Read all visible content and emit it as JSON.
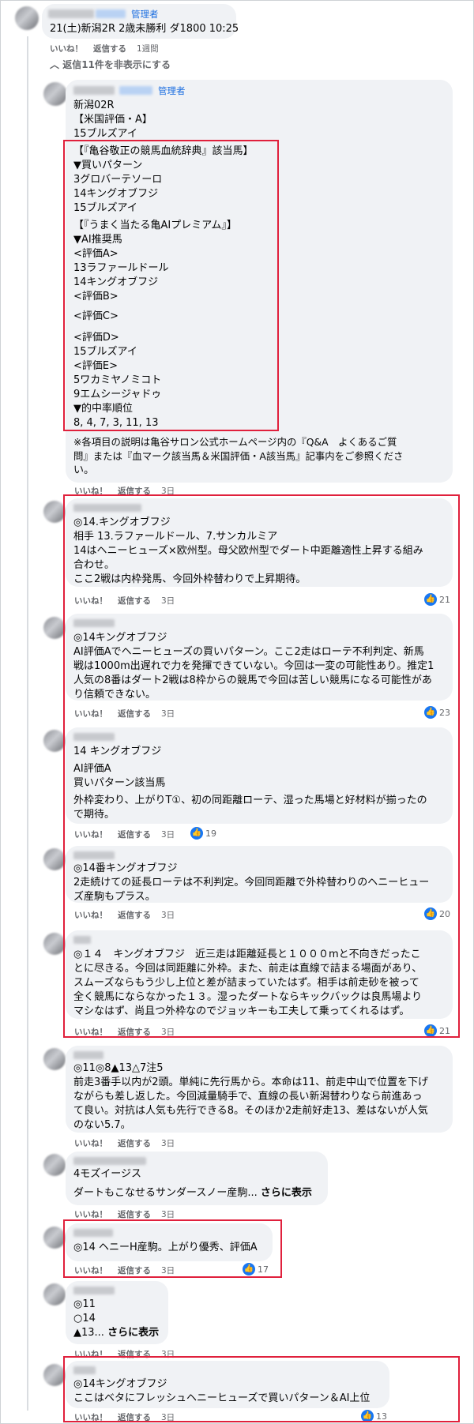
{
  "post": {
    "admin_badge": "管理者",
    "title": "21(土)新潟2R 2歳未勝利 ダ1800 10:25",
    "actions": {
      "like": "いいね！",
      "reply": "返信する",
      "time": "1週間"
    }
  },
  "hide_replies": "返信11件を非表示にする",
  "reply_admin": {
    "admin_badge": "管理者",
    "lines": [
      "新潟02R",
      "【米国評価・A】",
      "15ブルズアイ",
      "【『亀谷敬正の競馬血統辞典』該当馬】",
      "▼買いパターン",
      "3グロバーテソーロ",
      "14キングオブフジ",
      "15ブルズアイ",
      "【『うまく当たる亀AIプレミアム』】",
      "▼AI推奨馬",
      "<評価A>",
      "13ラファールドール",
      "14キングオブフジ",
      "<評価B>",
      "<評価C>",
      "<評価D>",
      "15ブルズアイ",
      "<評価E>",
      "5ワカミヤノミコト",
      "9エムシージャドゥ",
      "▼的中率順位",
      "8, 4, 7, 3, 11, 13",
      "※各項目の説明は亀谷サロン公式ホームページ内の『Q&A　よくあるご質",
      "問』または『血マーク該当馬＆米国評価・A該当馬』記事内をご参照くださ",
      "い。"
    ],
    "actions": {
      "like": "いいね！",
      "reply": "返信する",
      "time": "3日"
    }
  },
  "comments": [
    {
      "lines": [
        "◎14.キングオブフジ",
        "相手 13.ラファールドール、7.サンカルミア",
        "14はヘニーヒューズ×欧州型。母父欧州型でダート中距離適性上昇する組み",
        "合わせ。",
        "ここ2戦は内枠発馬、今回外枠替わりで上昇期待。"
      ],
      "actions": {
        "like": "いいね！",
        "reply": "返信する",
        "time": "3日"
      },
      "likes": "21"
    },
    {
      "lines": [
        "◎14キングオブフジ",
        "AI評価Aでヘニーヒューズの買いパターン。ここ2走はローテ不利判定、新馬",
        "戦は1000m出遅れで力を発揮できていない。今回は一変の可能性あり。推定1",
        "人気の8番はダート2戦は8枠からの競馬で今回は苦しい競馬になる可能性があ",
        "り信頼できない。"
      ],
      "actions": {
        "like": "いいね！",
        "reply": "返信する",
        "time": "3日"
      },
      "likes": "23"
    },
    {
      "lines": [
        "14 キングオブフジ",
        "AI評価A",
        "買いパターン該当馬",
        "外枠変わり、上がりT①、初の同距離ローテ、湿った馬場と好材料が揃ったの",
        "で期待。"
      ],
      "actions": {
        "like": "いいね！",
        "reply": "返信する",
        "time": "3日"
      },
      "likes": "19"
    },
    {
      "lines": [
        "◎14番キングオブフジ",
        "2走続けての延長ローテは不利判定。今回同距離で外枠替わりのヘニーヒュー",
        "ズ産駒もプラス。"
      ],
      "actions": {
        "like": "いいね！",
        "reply": "返信する",
        "time": "3日"
      },
      "likes": "20"
    },
    {
      "lines": [
        "◎１４　キングオブフジ　近三走は距離延長と１０００mと不向きだったこ",
        "とに尽きる。今回は同距離に外枠。また、前走は直線で詰まる場面があり、",
        "スムーズならもう少し上位と差が詰まっていたはず。相手は前走砂を被って",
        "全く競馬にならなかった１３。湿ったダートならキックバックは良馬場より",
        "マシなはず、尚且つ外枠なのでジョッキーも工夫して乗ってくれるはず。"
      ],
      "actions": {
        "like": "いいね！",
        "reply": "返信する",
        "time": "3日"
      },
      "likes": "21"
    },
    {
      "lines": [
        "◎11◎8▲13△7注5",
        "前走3番手以内が2頭。単純に先行馬から。本命は11、前走中山で位置を下げ",
        "ながらも差し返した。今回減量騎手で、直線の長い新潟替わりなら前進あっ",
        "て良い。対抗は人気も先行できる8。そのほか2走前好走13、差はないが人気",
        "のない5.7。"
      ],
      "actions": {
        "like": "いいね！",
        "reply": "返信する",
        "time": "3日"
      }
    },
    {
      "lines": [
        "4モズイージス",
        "ダートもこなせるサンダースノー産駒..."
      ],
      "see_more": "さらに表示",
      "actions": {
        "like": "いいね！",
        "reply": "返信する",
        "time": "3日"
      }
    },
    {
      "lines": [
        "◎14 ヘニーH産駒。上がり優秀、評価A"
      ],
      "actions": {
        "like": "いいね！",
        "reply": "返信する",
        "time": "3日"
      },
      "likes": "17"
    },
    {
      "lines": [
        "◎11",
        "○14",
        "▲13..."
      ],
      "see_more": "さらに表示",
      "actions": {
        "like": "いいね！",
        "reply": "返信する",
        "time": "3日"
      }
    },
    {
      "lines": [
        "◎14キングオブフジ",
        "ここはベタにフレッシュヘニーヒューズで買いパターン＆AI上位"
      ],
      "actions": {
        "like": "いいね！",
        "reply": "返信する",
        "time": "3日"
      },
      "likes": "13"
    }
  ],
  "colors": {
    "highlight": "#e0203c",
    "bubble": "#f0f2f5",
    "admin": "#1d6fe0",
    "like": "#1877f2"
  }
}
